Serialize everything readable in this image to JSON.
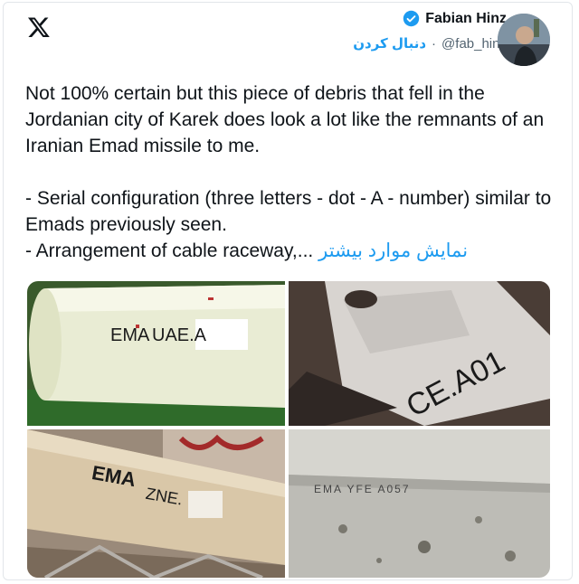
{
  "header": {
    "logo_icon": "x-logo-icon",
    "display_name": "Fabian Hinz",
    "verified_icon": "verified-badge-icon",
    "follow_label": "دنبال کردن",
    "separator": "·",
    "handle": "@fab_hinz"
  },
  "tweet": {
    "paragraph1": "Not 100% certain but this piece of debris that fell in the Jordanian city of Karek does look a lot like the remnants of an Iranian Emad missile to me.",
    "bullet1": "- Serial configuration (three letters - dot - A - number) similar to Emads previously seen.",
    "bullet2": "- Arrangement of cable raceway,...",
    "show_more": "نمایش موارد بیشتر"
  },
  "media": {
    "photo1": {
      "text1": "EMA",
      "text2": "UAE.A"
    },
    "photo2": {
      "text": "CE.A01"
    },
    "photo3": {
      "text1": "EMA",
      "text2": "ZNE."
    },
    "photo4": {
      "text": "EMA  YFE  A057"
    }
  }
}
